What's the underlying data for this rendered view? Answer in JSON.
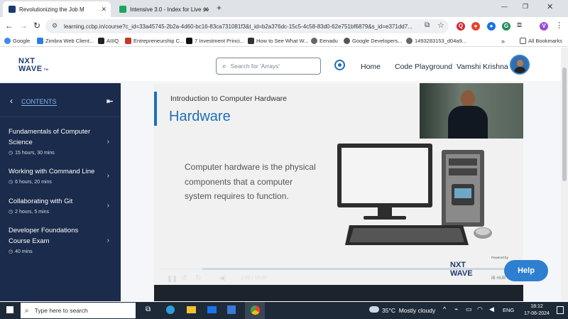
{
  "browser": {
    "tabs": [
      {
        "title": "Revolutionizing the Job M",
        "active": true
      },
      {
        "title": "Intensive 3.0 - Index for Live se",
        "active": false
      }
    ],
    "new_tab": "+",
    "url": "learning.ccbp.in/course?c_id=33a45745-2b2a-4d60-bc16-83ca731081f3&t_id=b2a376dc-15c5-4c58-83d0-62e751bf6879&s_id=e371dd7...",
    "profile_initial": "V",
    "bookmarks": [
      "Google",
      "Zimbra Web Client...",
      "AIIIQ",
      "Entrepreneurship C...",
      "7 Investment Princi...",
      "How to See What W...",
      "Eenadu",
      "Google Developers...",
      "1493283153_d04a9..."
    ],
    "all_bookmarks": "All Bookmarks"
  },
  "site": {
    "logo_top": "NXT",
    "logo_bottom": "WAVE",
    "logo_tm": "TM",
    "search_placeholder": "Search for 'Arrays'",
    "nav": {
      "home": "Home",
      "playground": "Code Playground",
      "user": "Vamshi Krishna"
    }
  },
  "sidebar": {
    "heading": "CONTENTS",
    "sections": [
      {
        "title": "Fundamentals of Computer Science",
        "duration": "15 hours, 30 mins"
      },
      {
        "title": "Working with Command Line",
        "duration": "6 hours, 20 mins"
      },
      {
        "title": "Collaborating with Git",
        "duration": "2 hours, 5 mins"
      },
      {
        "title": "Developer Foundations Course Exam",
        "duration": "40 mins"
      }
    ]
  },
  "video": {
    "subtitle": "Introduction to Computer Hardware",
    "title": "Hardware",
    "body": "Computer hardware is the physical components that a computer system requires to function.",
    "brand_top": "NXT",
    "brand_bottom": "WAVE",
    "powered_by": "Powered by",
    "partner": "IB HUB",
    "time": "2:05 / 15:00",
    "progress": 0.12
  },
  "help_button": "Help",
  "taskbar": {
    "search_placeholder": "Type here to search",
    "weather": "35°C  Mostly cloudy",
    "lang": "ENG",
    "time": "18:12",
    "date": "17-06-2024"
  },
  "colors": {
    "sidebar": "#1b2b4b",
    "accent": "#1f6fb8",
    "help": "#2f7fd0"
  }
}
